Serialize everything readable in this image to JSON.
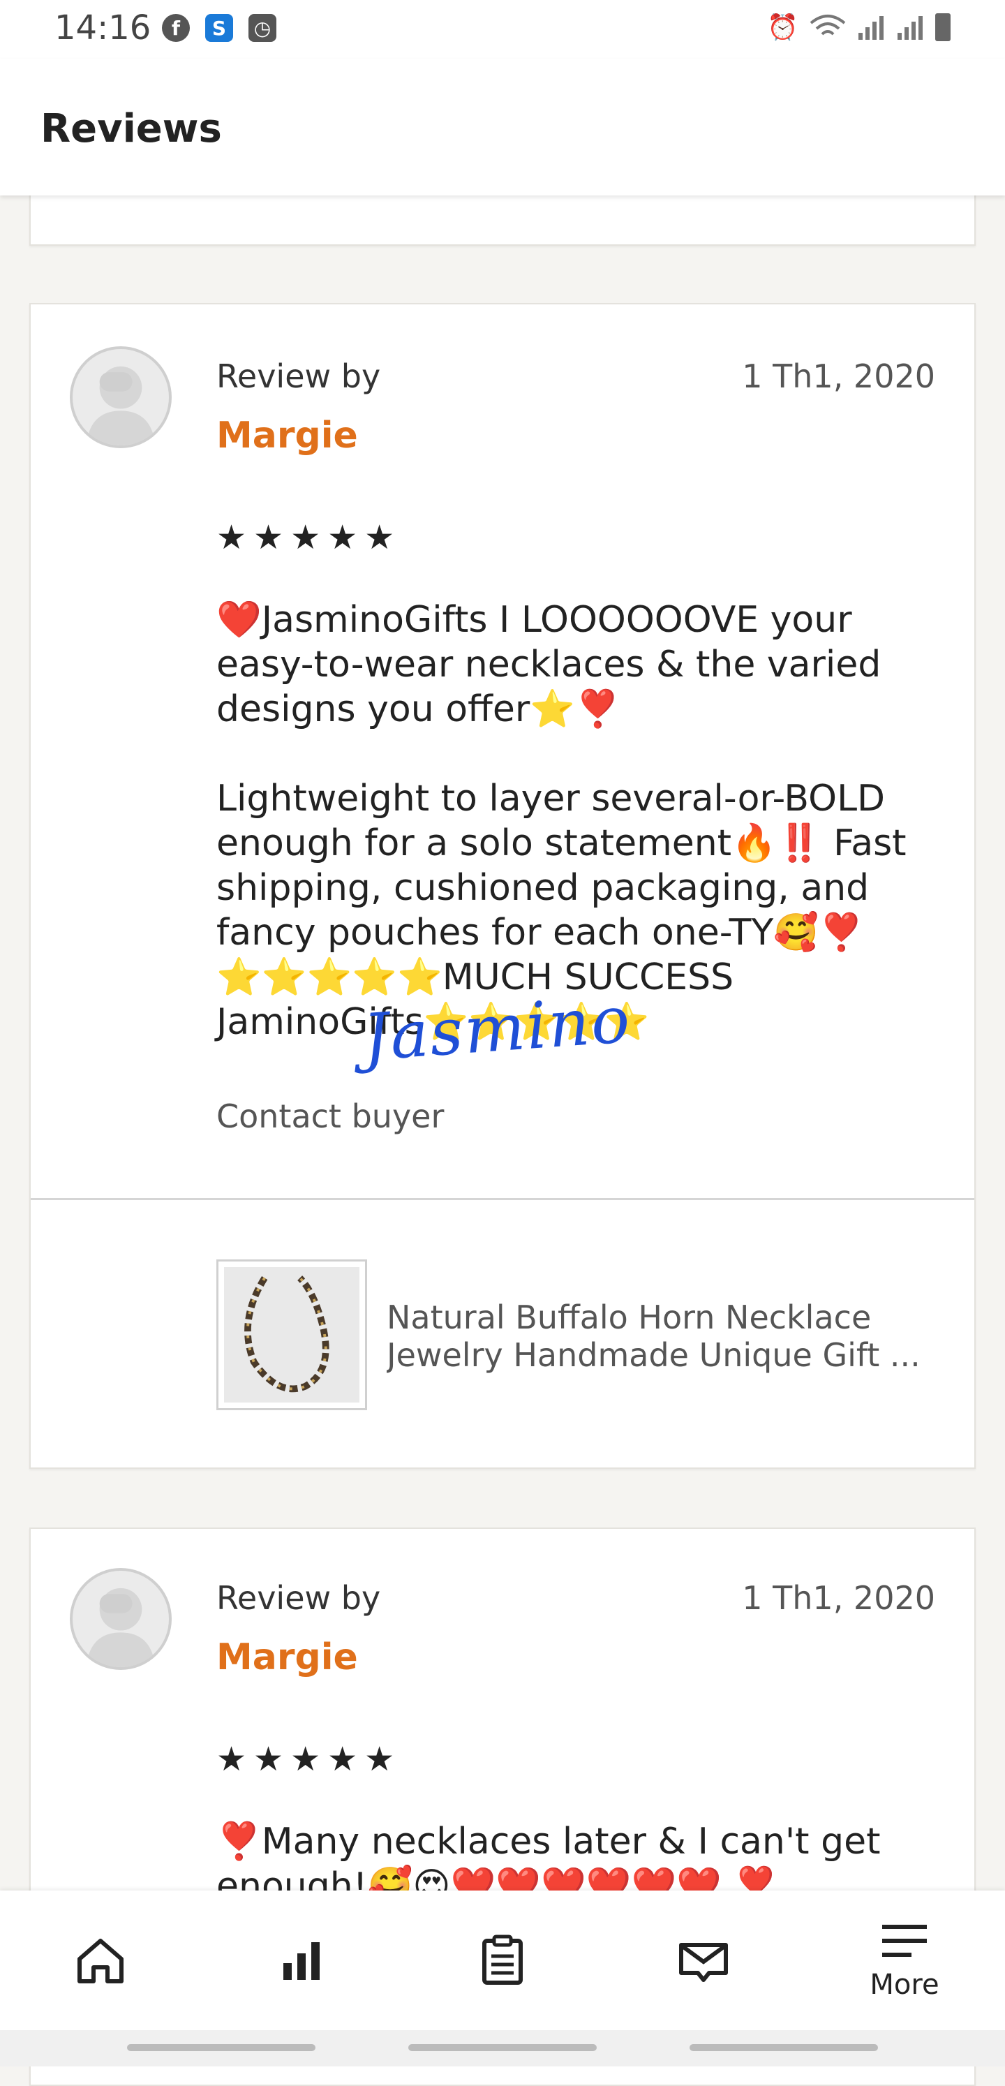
{
  "status_bar": {
    "time": "14:16",
    "left_icons": [
      "facebook-icon",
      "s-app-icon",
      "clock-app-icon"
    ],
    "right_icons": [
      "alarm-icon",
      "wifi-icon",
      "signal-icon",
      "signal-icon-2",
      "battery-icon"
    ]
  },
  "header": {
    "title": "Reviews"
  },
  "reviews": [
    {
      "review_by_label": "Review by",
      "reviewer": "Margie",
      "date": "1 Th1, 2020",
      "stars": "★★★★★",
      "rating": 5,
      "text": "❤️JasminoGifts I LOOOOOOVE your easy-to-wear necklaces & the varied designs you offer⭐❣️\n\nLightweight to layer several-or-BOLD enough for a solo statement🔥‼️ Fast shipping, cushioned packaging, and fancy pouches for each one-TY🥰❣️⭐⭐⭐⭐⭐MUCH SUCCESS JaminoGifts⭐⭐⭐⭐⭐",
      "contact_label": "Contact buyer",
      "listing_title_line1": "Natural Buffalo Horn Necklace",
      "listing_title_line2": "Jewelry Handmade Unique Gift ..."
    },
    {
      "review_by_label": "Review by",
      "reviewer": "Margie",
      "date": "1 Th1, 2020",
      "stars": "★★★★★",
      "rating": 5,
      "text": "❣️Many necklaces later & I can't get enough!🥰😍❤️❤️❤️❤️❤️❤️ ❣️"
    }
  ],
  "watermark": "Jasmino",
  "bottom_nav": {
    "items": [
      {
        "icon": "home-icon",
        "label": ""
      },
      {
        "icon": "stats-icon",
        "label": ""
      },
      {
        "icon": "orders-icon",
        "label": ""
      },
      {
        "icon": "messages-icon",
        "label": ""
      },
      {
        "icon": "menu-icon",
        "label": "More"
      }
    ]
  },
  "colors": {
    "accent": "#e0701a",
    "background": "#f5f4f1",
    "signature": "#1f4fd6"
  }
}
